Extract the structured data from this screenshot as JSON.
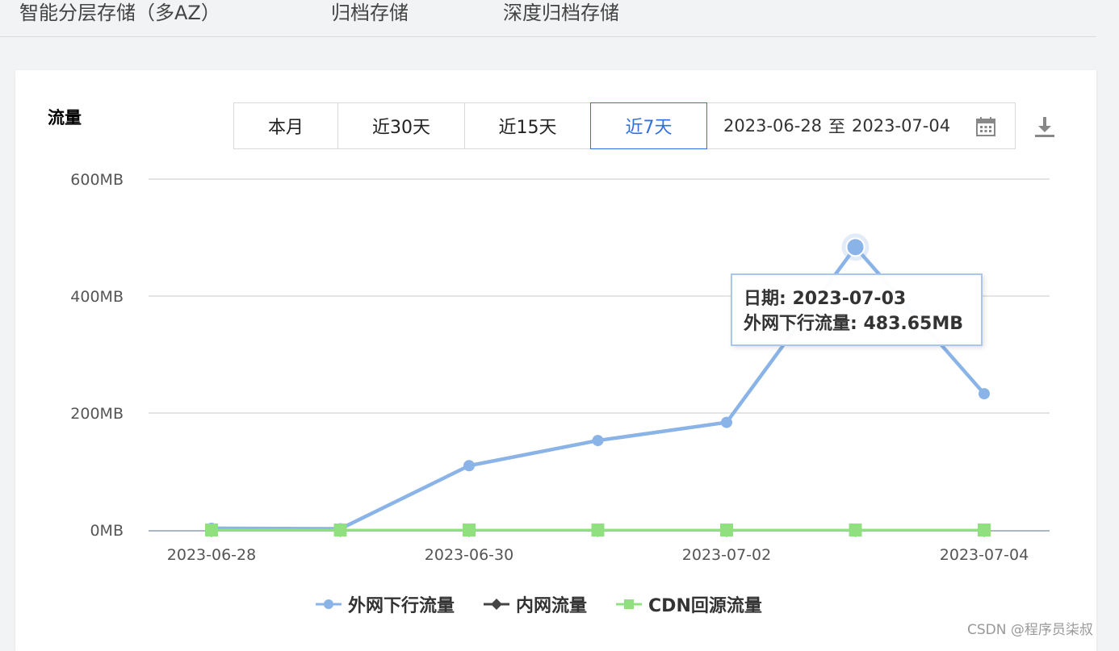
{
  "top_tabs": [
    "智能分层存储（多AZ）",
    "归档存储",
    "深度归档存储"
  ],
  "section_title": "流量",
  "range_buttons": [
    "本月",
    "近30天",
    "近15天",
    "近7天"
  ],
  "selected_range": "近7天",
  "date_range": {
    "start": "2023-06-28",
    "sep": "至",
    "end": "2023-07-04"
  },
  "icons": {
    "calendar": "calendar-icon",
    "download": "download-icon"
  },
  "colors": {
    "accent": "#2f6ee3",
    "series_external": "#8ab4e8",
    "series_internal": "#444444",
    "series_cdn": "#90e080"
  },
  "tooltip": {
    "date_line": "日期: 2023-07-03",
    "value_line": "外网下行流量: 483.65MB"
  },
  "watermark": "CSDN @程序员柒叔",
  "chart_data": {
    "type": "line",
    "x": [
      "2023-06-28",
      "2023-06-29",
      "2023-06-30",
      "2023-07-01",
      "2023-07-02",
      "2023-07-03",
      "2023-07-04"
    ],
    "x_tick_labels": [
      "2023-06-28",
      "2023-06-30",
      "2023-07-02",
      "2023-07-04"
    ],
    "y_ticks": [
      "0MB",
      "200MB",
      "400MB",
      "600MB"
    ],
    "ylim": [
      0,
      600
    ],
    "y_unit": "MB",
    "grid": true,
    "legend_position": "bottom",
    "series": [
      {
        "name": "外网下行流量",
        "marker": "circle",
        "values": [
          3,
          2,
          110,
          153,
          184,
          483.65,
          233
        ]
      },
      {
        "name": "内网流量",
        "marker": "diamond",
        "values": [
          0,
          0,
          0,
          0,
          0,
          0,
          0
        ]
      },
      {
        "name": "CDN回源流量",
        "marker": "square",
        "values": [
          0,
          0,
          0,
          0,
          0,
          0,
          0
        ]
      }
    ],
    "highlighted_point": {
      "series": "外网下行流量",
      "x": "2023-07-03"
    }
  }
}
